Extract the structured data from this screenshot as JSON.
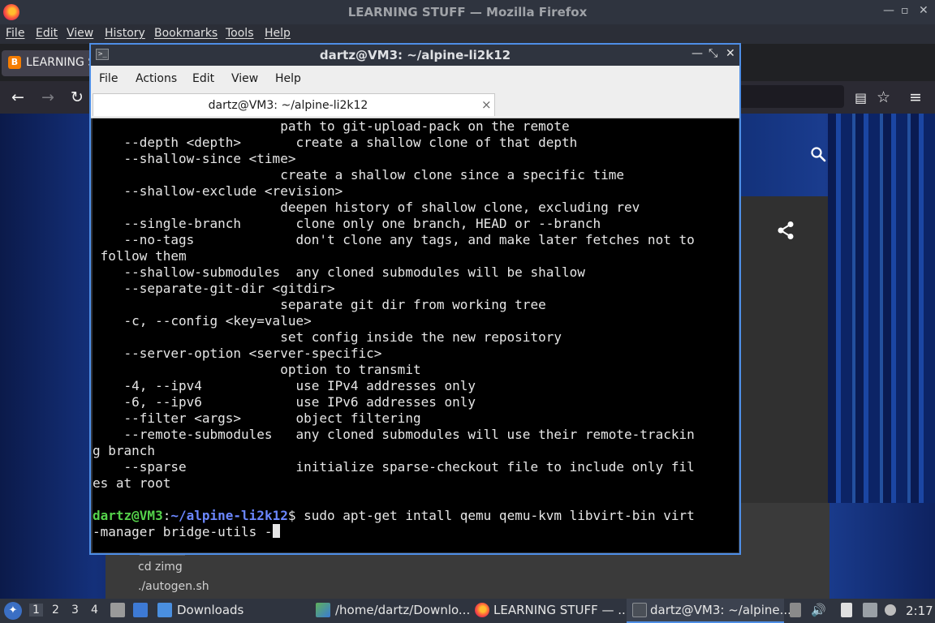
{
  "firefox": {
    "window_title": "LEARNING STUFF — Mozilla Firefox",
    "menu": [
      "File",
      "Edit",
      "View",
      "History",
      "Bookmarks",
      "Tools",
      "Help"
    ],
    "tab_label": "LEARNING S",
    "tab_favicon": "B",
    "page_lines": [
      "cd zimg",
      "./autogen.sh"
    ]
  },
  "terminal": {
    "window_title": "dartz@VM3: ~/alpine-li2k12",
    "menu": [
      "File",
      "Actions",
      "Edit",
      "View",
      "Help"
    ],
    "tab_label": "dartz@VM3: ~/alpine-li2k12",
    "tab_close": "×",
    "output_lines": [
      "                        path to git-upload-pack on the remote",
      "    --depth <depth>       create a shallow clone of that depth",
      "    --shallow-since <time>",
      "                        create a shallow clone since a specific time",
      "    --shallow-exclude <revision>",
      "                        deepen history of shallow clone, excluding rev",
      "    --single-branch       clone only one branch, HEAD or --branch",
      "    --no-tags             don't clone any tags, and make later fetches not to",
      " follow them",
      "    --shallow-submodules  any cloned submodules will be shallow",
      "    --separate-git-dir <gitdir>",
      "                        separate git dir from working tree",
      "    -c, --config <key=value>",
      "                        set config inside the new repository",
      "    --server-option <server-specific>",
      "                        option to transmit",
      "    -4, --ipv4            use IPv4 addresses only",
      "    -6, --ipv6            use IPv6 addresses only",
      "    --filter <args>       object filtering",
      "    --remote-submodules   any cloned submodules will use their remote-trackin",
      "g branch",
      "    --sparse              initialize sparse-checkout file to include only fil",
      "es at root",
      ""
    ],
    "prompt_user": "dartz@VM3",
    "prompt_sep": ":",
    "prompt_path": "~/alpine-li2k12",
    "prompt_dollar": "$ ",
    "command": "sudo apt-get intall qemu qemu-kvm libvirt-bin virt",
    "command_cont": "-manager bridge-utils -"
  },
  "taskbar": {
    "desktops": [
      "1",
      "2",
      "3",
      "4"
    ],
    "tasks": [
      {
        "label": "Downloads"
      },
      {
        "label": "/home/dartz/Downlo..."
      },
      {
        "label": "LEARNING STUFF — ..."
      },
      {
        "label": "dartz@VM3: ~/alpine..."
      }
    ],
    "clock": "2:17"
  },
  "colors": {
    "terminal_border": "#4e8ee6",
    "prompt_user": "#55d24b",
    "prompt_path": "#6b87ff"
  }
}
